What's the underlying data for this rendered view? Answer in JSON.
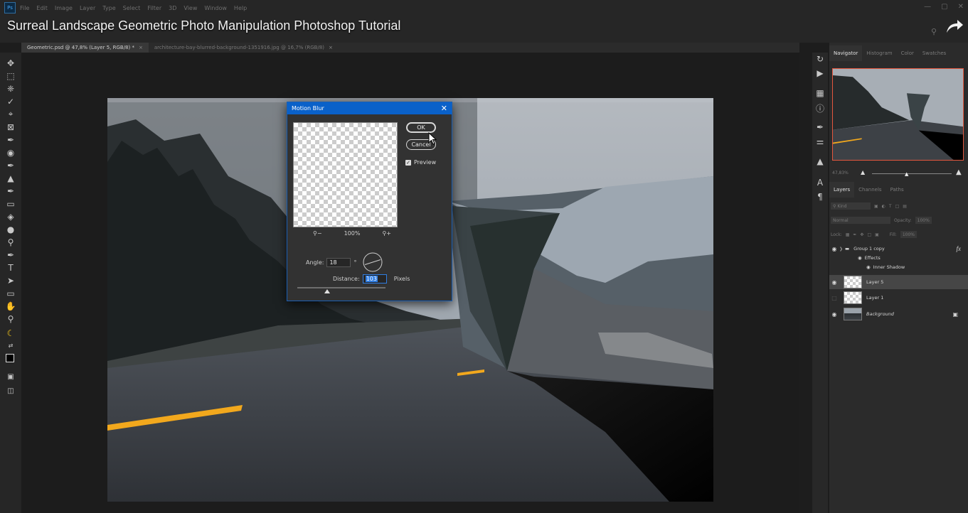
{
  "video_title": "Surreal Landscape Geometric Photo Manipulation Photoshop Tutorial",
  "app_icon": "Ps",
  "menu": [
    "File",
    "Edit",
    "Image",
    "Layer",
    "Type",
    "Select",
    "Filter",
    "3D",
    "View",
    "Window",
    "Help"
  ],
  "window_controls": [
    "—",
    "▢",
    "✕"
  ],
  "doc_tabs": [
    {
      "label": "Geometric.psd @ 47,8% (Layer 5, RGB/8) *",
      "close": "×"
    },
    {
      "label": "architecture-bay-blurred-background-1351916.jpg @ 16,7% (RGB/8)",
      "close": "×"
    }
  ],
  "navigator": {
    "tabs": [
      "Navigator",
      "Histogram",
      "Color",
      "Swatches"
    ],
    "zoom": "47,83%"
  },
  "layers_panel": {
    "tabs": [
      "Layers",
      "Channels",
      "Paths"
    ],
    "search_placeholder": "Kind",
    "blend_mode": "Normal",
    "opacity_label": "Opacity:",
    "opacity_value": "100%",
    "lock_label": "Lock:",
    "fill_label": "Fill:",
    "fill_value": "100%",
    "layers": [
      {
        "name": "Group 1 copy",
        "fx": "fx"
      },
      {
        "name": "Effects"
      },
      {
        "name": "Inner Shadow"
      },
      {
        "name": "Layer 5"
      },
      {
        "name": "Layer 1"
      },
      {
        "name": "Background"
      }
    ]
  },
  "dialog": {
    "title": "Motion Blur",
    "close": "✕",
    "ok_label": "OK",
    "cancel_label": "Cancel",
    "preview_label": "Preview",
    "preview_checked": true,
    "zoom_level": "100%",
    "angle_label": "Angle:",
    "angle_value": "18",
    "degree_symbol": "°",
    "distance_label": "Distance:",
    "distance_value": "103",
    "distance_unit": "Pixels"
  },
  "colors": {
    "accent_blue": "#0a61c9",
    "road_line": "#f2a81d",
    "nav_border": "#e3573e"
  }
}
